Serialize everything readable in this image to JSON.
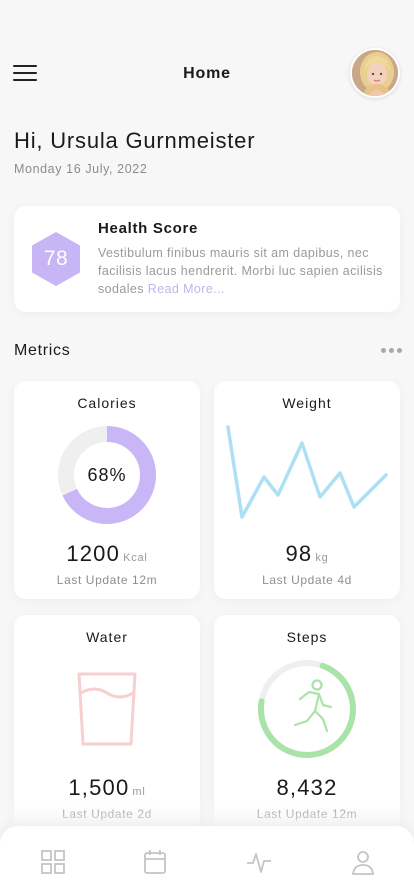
{
  "header": {
    "title": "Home",
    "menu_icon": "hamburger-menu-icon",
    "avatar_icon": "user-avatar"
  },
  "greeting": "Hi, Ursula Gurnmeister",
  "date": "Monday 16 July, 2022",
  "health": {
    "title": "Health Score",
    "score": "78",
    "description": "Vestibulum finibus mauris sit am dapibus, nec facilisis lacus hendrerit. Morbi luc sapien acilisis sodales",
    "read_more": "Read More...",
    "accent_color": "#c7b5f5"
  },
  "metrics": {
    "title": "Metrics",
    "more_icon": "more-horizontal-icon",
    "calories": {
      "title": "Calories",
      "percent_label": "68%",
      "progress": 0.68,
      "value": "1200",
      "unit": "Kcal",
      "update": "Last Update 12m",
      "color": "#c9b6f6"
    },
    "weight": {
      "title": "Weight",
      "value": "98",
      "unit": "kg",
      "update": "Last Update 4d",
      "color": "#aee0f3"
    },
    "water": {
      "title": "Water",
      "value": "1,500",
      "unit": "ml",
      "update": "Last Update 2d",
      "color": "#f7cfcf"
    },
    "steps": {
      "title": "Steps",
      "value": "8,432",
      "unit": "",
      "progress": 0.72,
      "update": "Last Update 12m",
      "color": "#a9e3a7"
    }
  },
  "tabbar": {
    "items": [
      {
        "icon": "grid-icon"
      },
      {
        "icon": "calendar-icon"
      },
      {
        "icon": "activity-icon"
      },
      {
        "icon": "profile-icon"
      }
    ]
  }
}
